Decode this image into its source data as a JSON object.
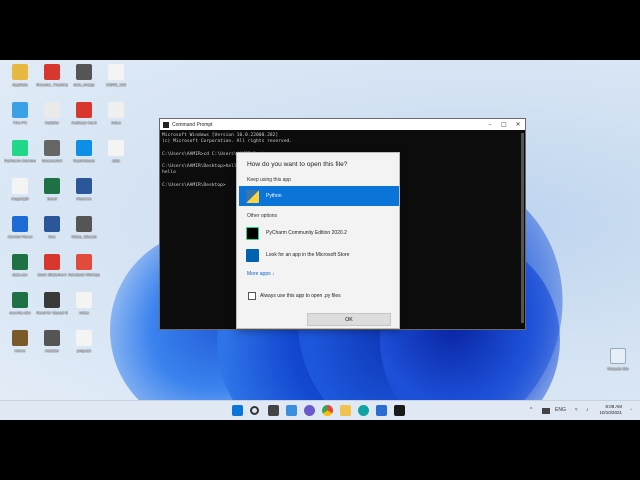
{
  "desktop": {
    "icons": [
      {
        "name": "apps-folder-icon",
        "label": "AppData",
        "color": "#e8b840"
      },
      {
        "name": "pdf-icon",
        "label": "Resume_Tracking Job Tracker",
        "color": "#d8372e"
      },
      {
        "name": "image-file-icon",
        "label": "data_image",
        "color": "#555555"
      },
      {
        "name": "text-file-icon",
        "label": "12345_123",
        "color": "#f4f4f4"
      },
      {
        "name": "this-pc-icon",
        "label": "This PC",
        "color": "#3aa0e8"
      },
      {
        "name": "installer-icon",
        "label": "Installer",
        "color": "#eaeaea"
      },
      {
        "name": "pdf-icon-2",
        "label": "Aadhaar Card",
        "color": "#d8372e"
      },
      {
        "name": "web-file-icon",
        "label": "Index",
        "color": "#f0f0f0"
      },
      {
        "name": "pycharm-icon",
        "label": "PyCharm Community...",
        "color": "#21d789"
      },
      {
        "name": "user-profile-icon",
        "label": "Screenshot",
        "color": "#666666"
      },
      {
        "name": "teamviewer-icon",
        "label": "TeamViewer",
        "color": "#0e8ee9"
      },
      {
        "name": "file-icon",
        "label": "data",
        "color": "#f4f4f4"
      },
      {
        "name": "copyright-icon",
        "label": "Copyright",
        "color": "#f4f4f4"
      },
      {
        "name": "excel-icon",
        "label": "Excel",
        "color": "#1e7145"
      },
      {
        "name": "word-icon",
        "label": "Resume",
        "color": "#2b579a"
      },
      {
        "name": "settings-app-icon",
        "label": "Control Panel",
        "color": "#1f6bd6"
      },
      {
        "name": "word-icon-2",
        "label": "Doc",
        "color": "#2b579a"
      },
      {
        "name": "video-file-icon",
        "label": "Video_Stream",
        "color": "#555555"
      },
      {
        "name": "excel-icon-2",
        "label": "data.csv",
        "color": "#1e7145"
      },
      {
        "name": "pdf-icon-3",
        "label": "Bank Statement",
        "color": "#d8372e"
      },
      {
        "name": "3d-objects-icon",
        "label": "Autodesk Workspace",
        "color": "#e24a3b"
      },
      {
        "name": "excel-icon-3",
        "label": "records.xlsx",
        "color": "#1e7145"
      },
      {
        "name": "game-icon",
        "label": "Need for Speed Most Wanted",
        "color": "#3a3a3a"
      },
      {
        "name": "file-icon-2",
        "label": "notes",
        "color": "#f4f4f4"
      },
      {
        "name": "home-icon",
        "label": "Home",
        "color": "#7a5a2a"
      },
      {
        "name": "installer-icon-2",
        "label": "Installer",
        "color": "#555555"
      },
      {
        "name": "file-icon-3",
        "label": "projects",
        "color": "#f4f4f4"
      }
    ],
    "recycle_bin_label": "Recycle Bin"
  },
  "cmd": {
    "title": "Command Prompt",
    "lines": [
      "Microsoft Windows [Version 10.0.22000.282]",
      "(c) Microsoft Corporation. All rights reserved.",
      "",
      "C:\\Users\\AAMIR>cd C:\\Users\\AAMIR\\Desktop",
      "",
      "C:\\Users\\AAMIR\\Desktop>hello.py",
      "hello",
      "",
      "C:\\Users\\AAMIR\\Desktop>"
    ]
  },
  "dialog": {
    "heading": "How do you want to open this file?",
    "keep_label": "Keep using this app",
    "selected_app": "Python",
    "other_label": "Other options",
    "other_apps": [
      "PyCharm Community Edition 2020.2",
      "Look for an app in the Microsoft Store"
    ],
    "more_apps": "More apps ↓",
    "always_label": "Always use this app to open .py files",
    "always_checked": false,
    "ok_label": "OK"
  },
  "taskbar": {
    "time": "8:08 AM",
    "date": "10/10/2021",
    "tray_lang": "ENG"
  },
  "colors": {
    "accent": "#0a74d9",
    "taskbar": "#dfe8f3"
  }
}
